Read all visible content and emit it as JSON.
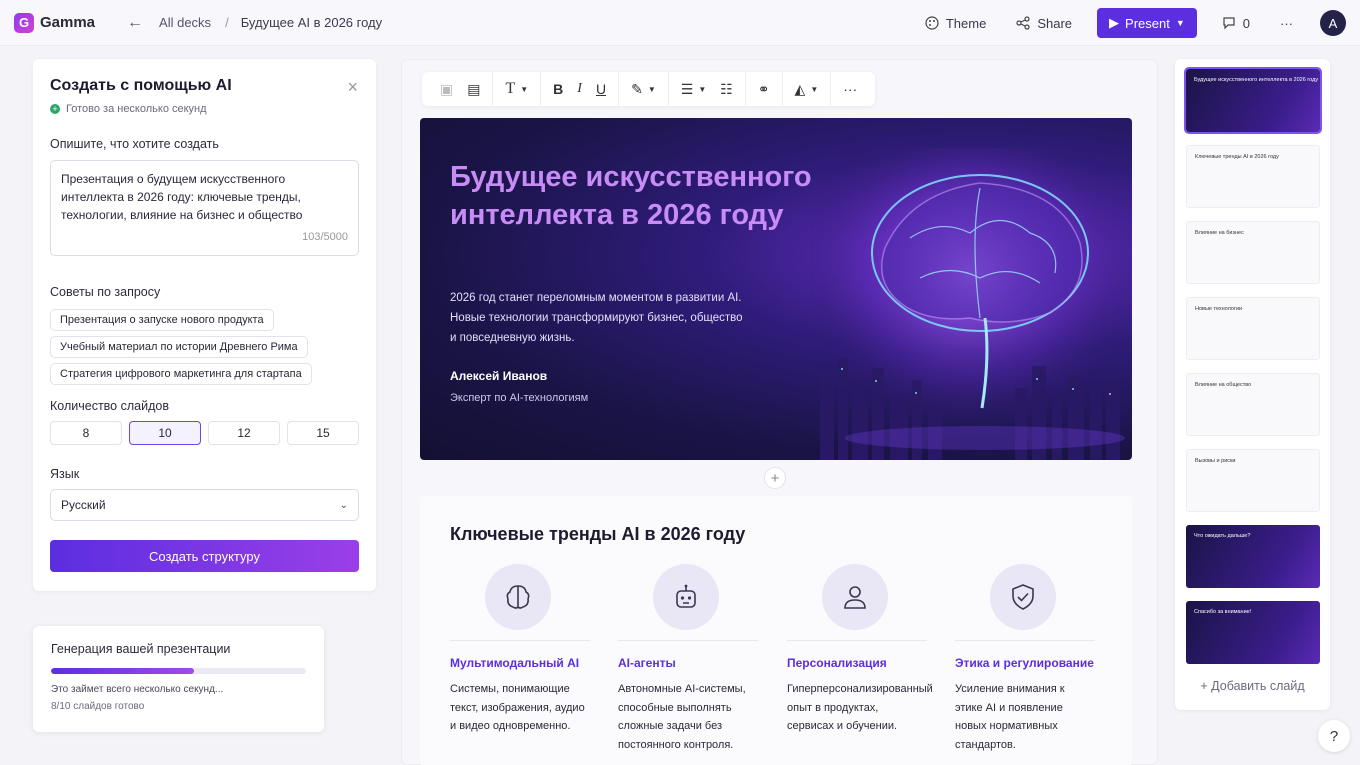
{
  "app": {
    "name": "Gamma",
    "logo_letter": "G"
  },
  "breadcrumb": {
    "back_icon": "arrow-left-icon",
    "parent": "All decks",
    "separator": "/",
    "current": "Будущее AI в 2026 году"
  },
  "topbar": {
    "theme": "Theme",
    "share": "Share",
    "present": "Present",
    "comments_count": "0",
    "more": "···",
    "avatar_letter": "A"
  },
  "left_panel": {
    "title": "Создать с помощью AI",
    "close": "×",
    "subtitle": "Готово за несколько секунд",
    "prompt_label": "Опишите, что хотите создать",
    "prompt_value": "Презентация о будущем искусственного интеллекта в 2026 году: ключевые тренды, технологии, влияние на бизнес и общество",
    "prompt_count": "103/5000",
    "tips_label": "Советы по запросу",
    "tips": [
      "Презентация о запуске нового продукта",
      "Учебный материал по истории Древнего Рима",
      "Стратегия цифрового маркетинга для стартапа"
    ],
    "slides_label": "Количество слайдов",
    "slide_counts": [
      "8",
      "10",
      "12",
      "15"
    ],
    "selected_count": "10",
    "language_label": "Язык",
    "language_value": "Русский",
    "create_button": "Создать структуру"
  },
  "generation": {
    "title": "Генерация вашей презентации",
    "progress": 0.56,
    "text": "Это займет всего несколько секунд...",
    "count": "8/10 слайдов готово"
  },
  "hero": {
    "title": "Будущее искусственного интеллекта в 2026 году",
    "description": "2026 год станет переломным моментом в развитии AI. Новые технологии трансформируют бизнес, общество и повседневную жизнь.",
    "author": "Алексей Иванов",
    "role": "Эксперт по AI-технологиям"
  },
  "trends_card": {
    "title": "Ключевые тренды AI в 2026 году",
    "items": [
      {
        "icon": "brain-icon",
        "name": "Мультимодальный AI",
        "desc": "Системы, понимающие текст, изображения, аудио и видео одновременно."
      },
      {
        "icon": "robot-icon",
        "name": "AI-агенты",
        "desc": "Автономные AI-системы, способные выполнять сложные задачи без постоянного контроля."
      },
      {
        "icon": "user-icon",
        "name": "Персонализация",
        "desc": "Гиперперсонализированный опыт в продуктах, сервисах и обучении."
      },
      {
        "icon": "shield-check-icon",
        "name": "Этика и регулирование",
        "desc": "Усиление внимания к этике AI и появление новых нормативных стандартов."
      }
    ]
  },
  "slides": {
    "thumbs": [
      {
        "title": "Будущее искусственного интеллекта в 2026 году",
        "style": "dark"
      },
      {
        "title": "Ключевые тренды AI в 2026 году",
        "style": "light"
      },
      {
        "title": "Влияние на бизнес",
        "style": "light"
      },
      {
        "title": "Новые технологии",
        "style": "light"
      },
      {
        "title": "Влияние на общество",
        "style": "light"
      },
      {
        "title": "Вызовы и риски",
        "style": "light"
      },
      {
        "title": "Что ожидать дальше?",
        "style": "dark"
      },
      {
        "title": "Спасибо за внимание!",
        "style": "dark"
      }
    ],
    "add_slide": "Добавить слайд"
  },
  "help": "?",
  "colors": {
    "accent": "#5b2ee0",
    "accent2": "#9b3fe8",
    "hero_title": "#c78cf5"
  }
}
